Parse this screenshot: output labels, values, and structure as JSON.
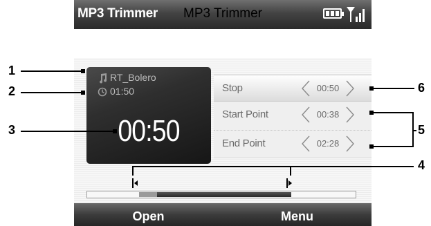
{
  "titlebar": {
    "app_name": "MP3 Trimmer",
    "icons": [
      "battery-icon",
      "signal-icon"
    ]
  },
  "header": {
    "title": "MP3 Trimmer"
  },
  "info_panel": {
    "track_name": "RT_Bolero",
    "track_length": "01:50",
    "current_time": "00:50",
    "icons": [
      "music-note-icon",
      "clock-icon"
    ]
  },
  "rows": [
    {
      "label": "Stop",
      "value": "00:50"
    },
    {
      "label": "Start Point",
      "value": "00:38"
    },
    {
      "label": "End Point",
      "value": "02:28"
    }
  ],
  "softkeys": {
    "left": "Open",
    "right": "Menu"
  },
  "callouts": [
    "1",
    "2",
    "3",
    "4",
    "5",
    "6"
  ],
  "colors": {
    "titlebar": "#434343",
    "panel": "#2f2f2f",
    "selection": "#3a3a3a"
  }
}
